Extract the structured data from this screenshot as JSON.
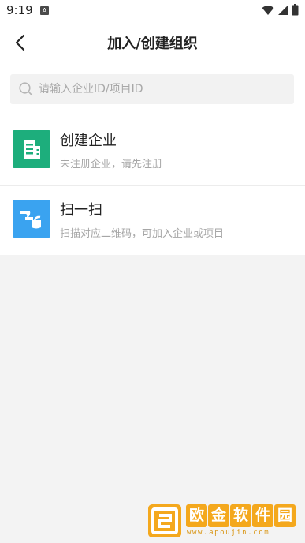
{
  "status_bar": {
    "time": "9:19",
    "notification_glyph": "A"
  },
  "header": {
    "title": "加入/创建组织",
    "back_icon": "chevron-left-icon"
  },
  "search": {
    "placeholder": "请输入企业ID/项目ID",
    "value": ""
  },
  "options": [
    {
      "title": "创建企业",
      "subtitle": "未注册企业，请先注册",
      "icon": "building-icon",
      "icon_color": "#1dae7c"
    },
    {
      "title": "扫一扫",
      "subtitle": "扫描对应二维码，可加入企业或项目",
      "icon": "scan-icon",
      "icon_color": "#3aa3f0"
    }
  ],
  "watermark": {
    "chars": [
      "欧",
      "金",
      "软",
      "件",
      "园"
    ],
    "url": "www.apoujin.com",
    "color": "#f4a81d"
  }
}
